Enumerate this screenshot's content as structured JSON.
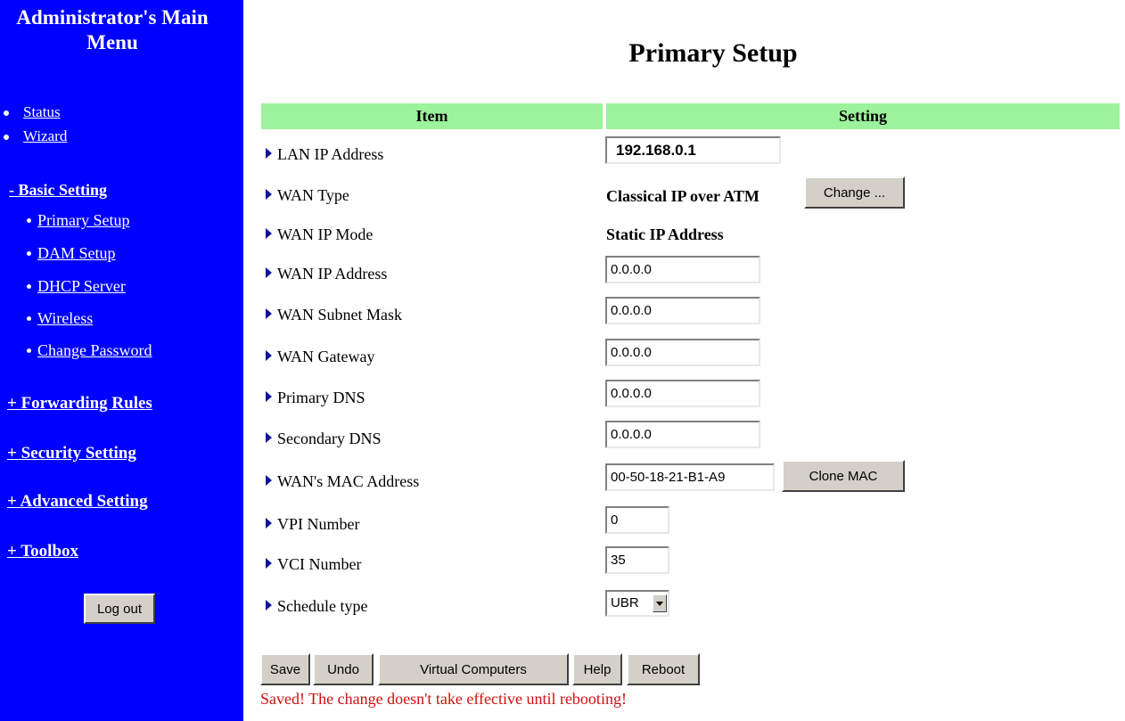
{
  "sidebar": {
    "title": "Administrator's Main Menu",
    "items": [
      {
        "label": "Status"
      },
      {
        "label": "Wizard"
      },
      {
        "label": "- Basic Setting"
      },
      {
        "label": "Primary Setup"
      },
      {
        "label": "DAM Setup"
      },
      {
        "label": "DHCP Server"
      },
      {
        "label": "Wireless"
      },
      {
        "label": "Change Password"
      },
      {
        "label": "+ Forwarding Rules"
      },
      {
        "label": "+ Security Setting"
      },
      {
        "label": "+ Advanced Setting"
      },
      {
        "label": "+ Toolbox"
      }
    ],
    "logout_label": "Log out"
  },
  "main": {
    "title": "Primary Setup",
    "table": {
      "col_item": "Item",
      "col_setting": "Setting"
    },
    "rows": {
      "lan_ip": {
        "label": "LAN IP Address",
        "value": "192.168.0.1"
      },
      "wan_type": {
        "label": "WAN Type",
        "value": "Classical IP over ATM",
        "button": "Change ..."
      },
      "wan_ip_mode": {
        "label": "WAN IP Mode",
        "value": "Static IP Address"
      },
      "wan_ip": {
        "label": "WAN IP Address",
        "value": "0.0.0.0"
      },
      "wan_mask": {
        "label": "WAN Subnet Mask",
        "value": "0.0.0.0"
      },
      "wan_gateway": {
        "label": "WAN Gateway",
        "value": "0.0.0.0"
      },
      "primary_dns": {
        "label": "Primary DNS",
        "value": "0.0.0.0"
      },
      "secondary_dns": {
        "label": "Secondary DNS",
        "value": "0.0.0.0"
      },
      "wan_mac": {
        "label": "WAN's MAC Address",
        "value": "00-50-18-21-B1-A9",
        "button": "Clone MAC"
      },
      "vpi": {
        "label": "VPI Number",
        "value": "0"
      },
      "vci": {
        "label": "VCI Number",
        "value": "35"
      },
      "schedule": {
        "label": "Schedule type",
        "value": "UBR"
      }
    },
    "actions": {
      "save": "Save",
      "undo": "Undo",
      "virtual_computers": "Virtual Computers",
      "help": "Help",
      "reboot": "Reboot"
    },
    "status_message": "Saved! The change doesn't take effective until rebooting!"
  },
  "colors": {
    "sidebar_bg": "#0000ff",
    "header_bg": "#9cf39c",
    "status_text": "#d01010"
  }
}
